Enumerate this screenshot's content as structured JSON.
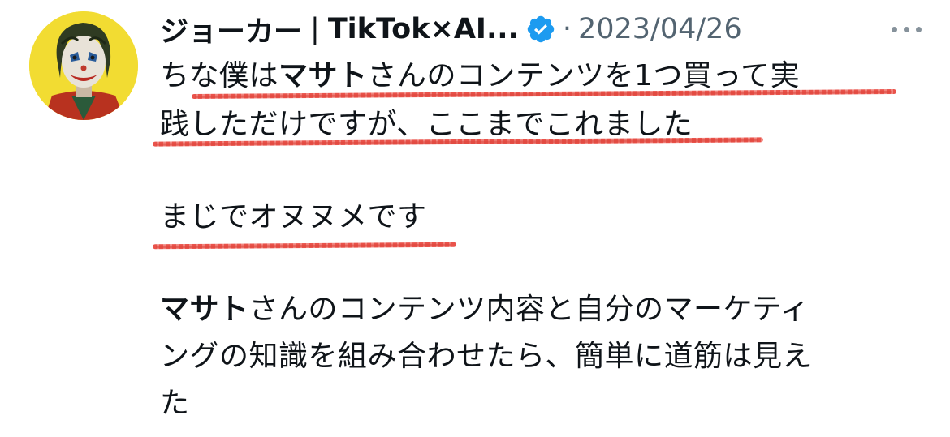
{
  "tweet": {
    "author": {
      "name_main": "ジョーカー",
      "name_separator": "|",
      "name_rest": "TikTok×AI...",
      "verified_icon": "verified-badge-icon",
      "verified_color": "#1d9bf0",
      "avatar_icon": "joker-avatar",
      "avatar_bg": "#f2dc32"
    },
    "dot": "·",
    "timestamp": "2023/04/26",
    "more_icon": "more-options-icon",
    "body": {
      "line1": {
        "before": "ちな僕は",
        "bold": "マサト",
        "after": "さんのコンテンツを1つ買って実"
      },
      "line2": "践しただけですが、ここまでこれました",
      "line3": "まじでオヌヌメです",
      "line4": {
        "bold": "マサト",
        "after": "さんのコンテンツ内容と自分のマーケティ"
      },
      "line5": "ングの知識を組み合わせたら、簡単に道筋は見え",
      "line6": "た"
    },
    "highlight_color": "#e8453c"
  }
}
